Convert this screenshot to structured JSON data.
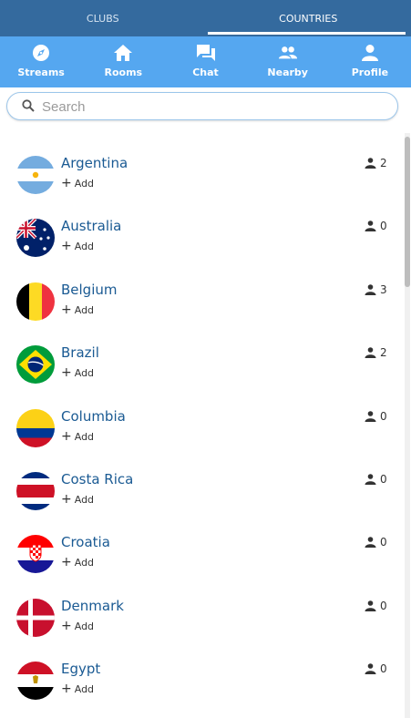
{
  "top_tabs": [
    {
      "label": "CLUBS"
    },
    {
      "label": "COUNTRIES"
    }
  ],
  "nav": [
    {
      "label": "Streams",
      "icon": "compass-icon"
    },
    {
      "label": "Rooms",
      "icon": "home-icon"
    },
    {
      "label": "Chat",
      "icon": "chat-icon"
    },
    {
      "label": "Nearby",
      "icon": "people-icon"
    },
    {
      "label": "Profile",
      "icon": "user-icon"
    }
  ],
  "search": {
    "placeholder": "Search",
    "value": ""
  },
  "countries": [
    {
      "name": "Argentina",
      "add_label": "Add",
      "count": "2"
    },
    {
      "name": "Australia",
      "add_label": "Add",
      "count": "0"
    },
    {
      "name": "Belgium",
      "add_label": "Add",
      "count": "3"
    },
    {
      "name": "Brazil",
      "add_label": "Add",
      "count": "2"
    },
    {
      "name": "Columbia",
      "add_label": "Add",
      "count": "0"
    },
    {
      "name": "Costa Rica",
      "add_label": "Add",
      "count": "0"
    },
    {
      "name": "Croatia",
      "add_label": "Add",
      "count": "0"
    },
    {
      "name": "Denmark",
      "add_label": "Add",
      "count": "0"
    },
    {
      "name": "Egypt",
      "add_label": "Add",
      "count": "0"
    }
  ],
  "colors": {
    "topbar": "#346a9e",
    "navbar": "#55a7f0",
    "country_name": "#1a5a93"
  }
}
